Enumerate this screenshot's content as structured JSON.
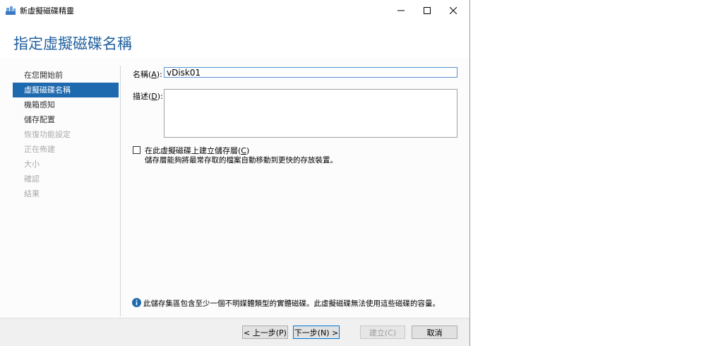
{
  "window": {
    "title": "新虛擬磁碟精靈"
  },
  "page_title": "指定虛擬磁碟名稱",
  "nav": {
    "items": [
      {
        "label": "在您開始前",
        "state": "normal"
      },
      {
        "label": "虛擬磁碟名稱",
        "state": "selected"
      },
      {
        "label": "機箱感知",
        "state": "normal"
      },
      {
        "label": "儲存配置",
        "state": "normal"
      },
      {
        "label": "恢復功能設定",
        "state": "disabled"
      },
      {
        "label": "正在佈建",
        "state": "disabled"
      },
      {
        "label": "大小",
        "state": "disabled"
      },
      {
        "label": "確認",
        "state": "disabled"
      },
      {
        "label": "結果",
        "state": "disabled"
      }
    ]
  },
  "form": {
    "name_label": "名稱(",
    "name_key": "A",
    "name_label_end": "):",
    "name_value": "vDisk01",
    "desc_label": "描述(",
    "desc_key": "D",
    "desc_label_end": "):",
    "desc_value": "",
    "tier_label": "在此虛擬磁碟上建立儲存層(",
    "tier_key": "C",
    "tier_label_end": ")",
    "tier_checked": false,
    "tier_desc": "儲存層能夠將最常存取的檔案自動移動到更快的存放裝置。"
  },
  "info_text": "此儲存集區包含至少一個不明媒體類型的實體磁碟。此虛擬磁碟無法使用這些磁碟的容量。",
  "footer": {
    "prev": "< 上一步(P)",
    "next": "下一步(N) >",
    "create": "建立(C)",
    "cancel": "取消"
  },
  "colors": {
    "accent": "#1f6aae",
    "title": "#1f5f9d",
    "info_icon": "#1f6aae"
  }
}
